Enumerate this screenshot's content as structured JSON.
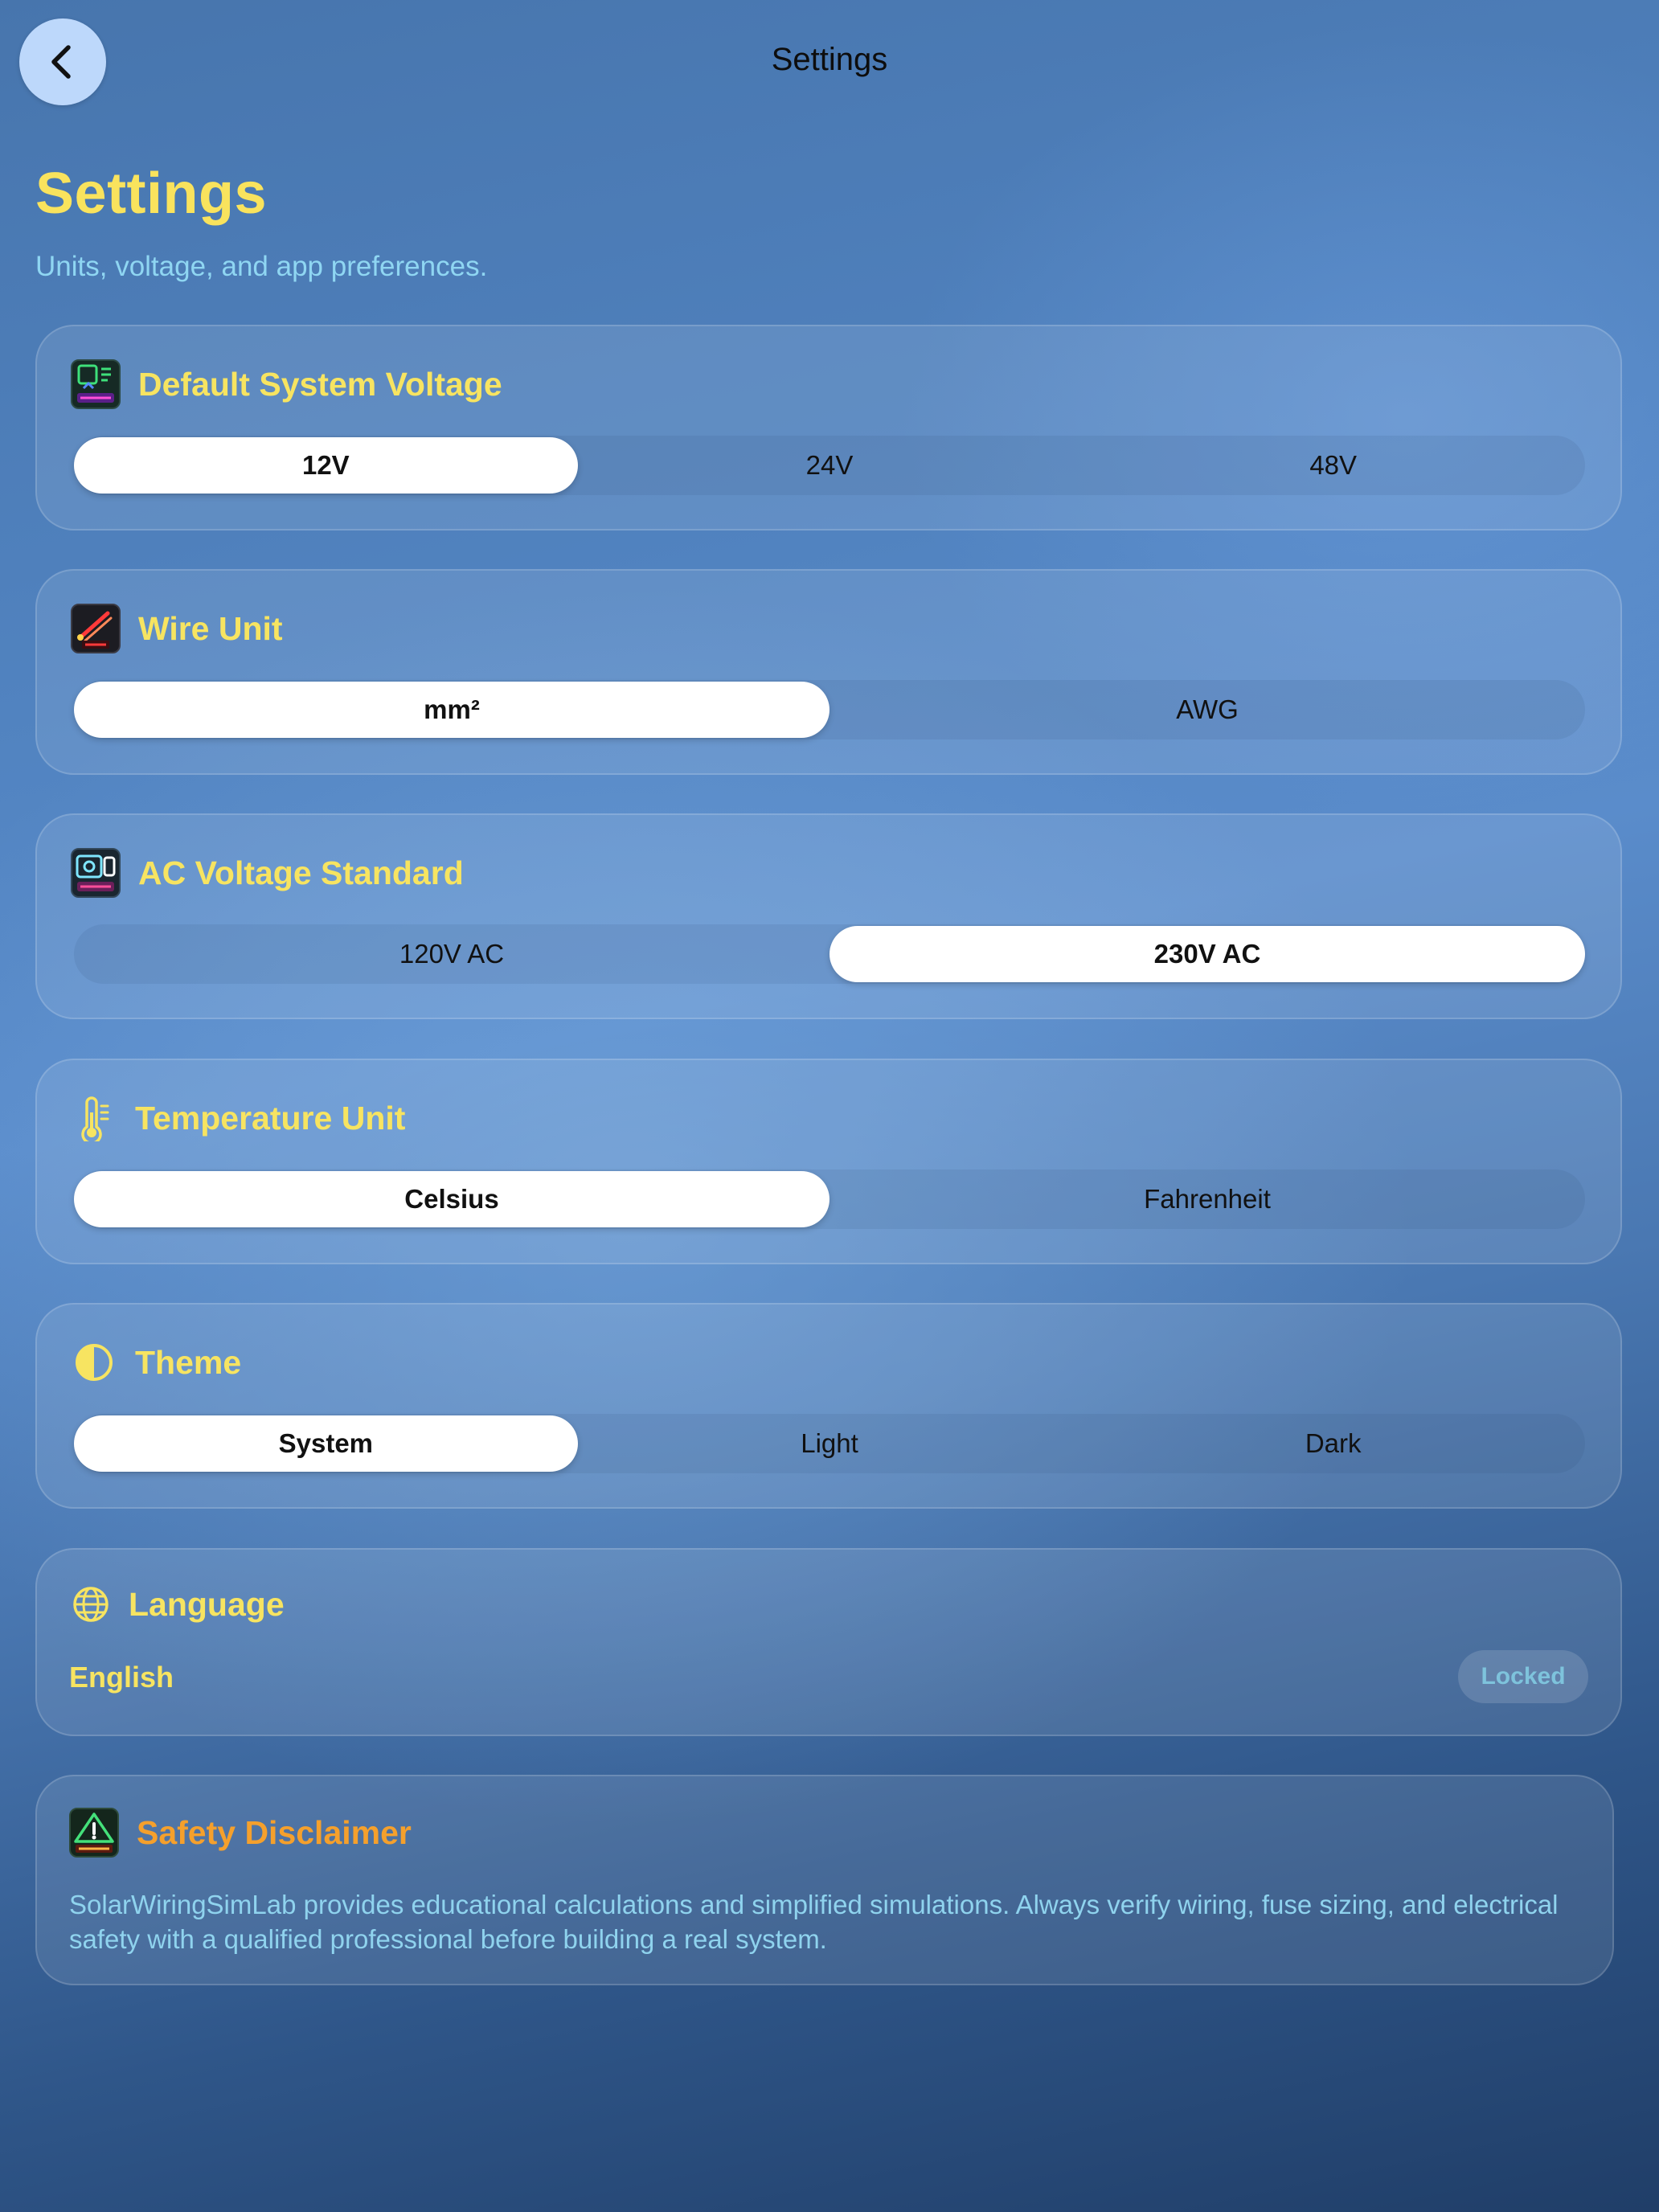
{
  "nav": {
    "title": "Settings",
    "back_icon": "chevron-left-icon"
  },
  "header": {
    "title": "Settings",
    "subtitle": "Units, voltage, and app preferences."
  },
  "sections": {
    "voltage": {
      "title": "Default System Voltage",
      "icon": "mppt-controller-icon",
      "options": [
        "12V",
        "24V",
        "48V"
      ],
      "selected": "12V"
    },
    "wire": {
      "title": "Wire Unit",
      "icon": "wire-icon",
      "options": [
        "mm²",
        "AWG"
      ],
      "selected": "mm²"
    },
    "ac": {
      "title": "AC Voltage Standard",
      "icon": "ac-load-icon",
      "options": [
        "120V AC",
        "230V AC"
      ],
      "selected": "230V AC"
    },
    "temperature": {
      "title": "Temperature Unit",
      "icon": "thermometer-icon",
      "options": [
        "Celsius",
        "Fahrenheit"
      ],
      "selected": "Celsius"
    },
    "theme": {
      "title": "Theme",
      "icon": "half-circle-contrast-icon",
      "options": [
        "System",
        "Light",
        "Dark"
      ],
      "selected": "System"
    },
    "language": {
      "title": "Language",
      "icon": "globe-icon",
      "value": "English",
      "status": "Locked"
    },
    "disclaimer": {
      "title": "Safety Disclaimer",
      "icon": "warning-icon",
      "text": "SolarWiringSimLab provides educational calculations and simplified simulations. Always verify wiring, fuse sizing, and electrical safety with a qualified professional before building a real system."
    }
  },
  "colors": {
    "accent_yellow": "#f7e461",
    "subtitle_cyan": "#8fd6f2",
    "warning_orange": "#f5a02c",
    "background_top": "#4775ad",
    "background_bottom": "#203e68"
  }
}
